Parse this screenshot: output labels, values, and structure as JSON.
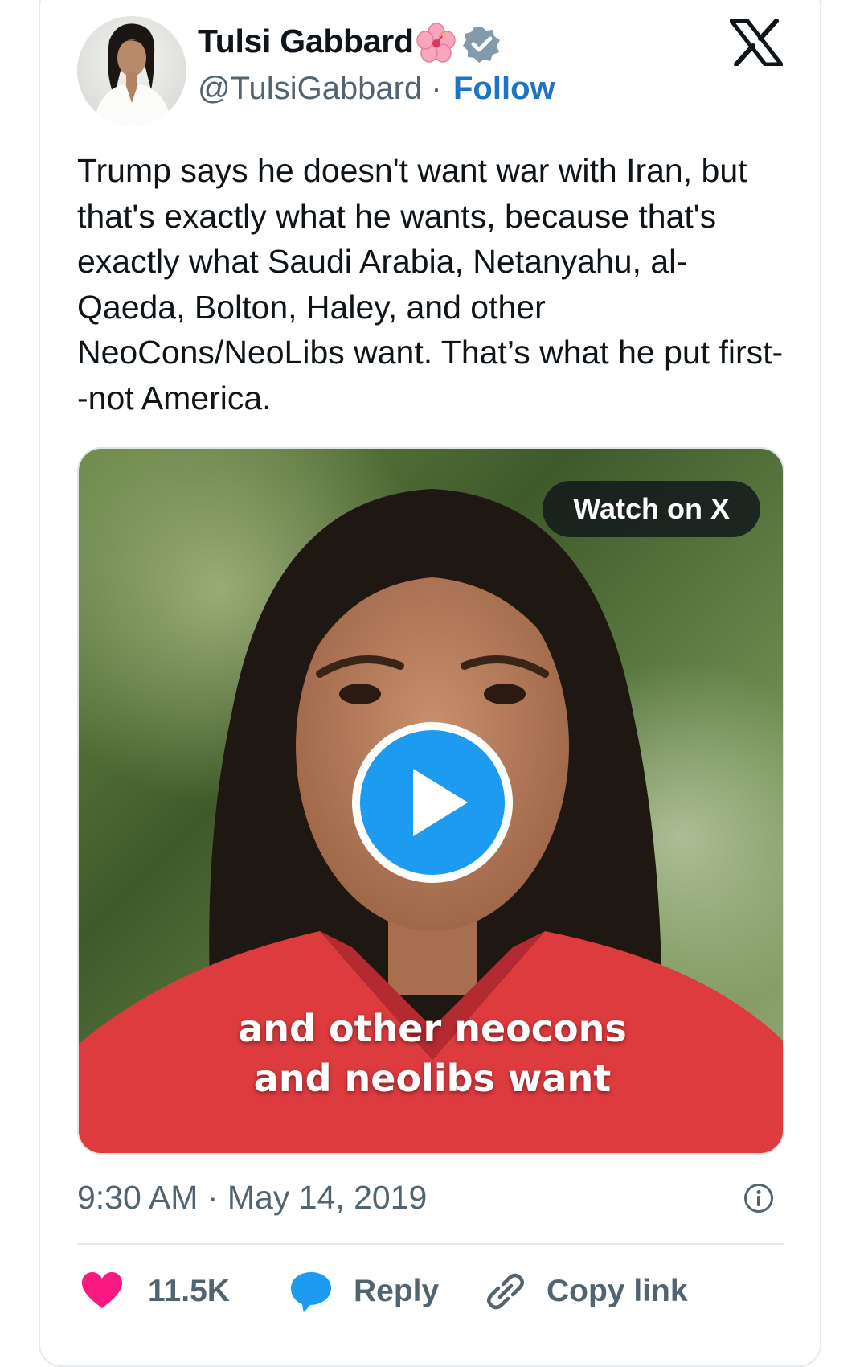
{
  "author": {
    "name": "Tulsi Gabbard",
    "handle": "@TulsiGabbard",
    "separator": "·",
    "follow_label": "Follow",
    "name_emoji_icon": "hibiscus-icon",
    "verified_icon": "verified-badge-icon"
  },
  "platform_icon": "x-logo-icon",
  "tweet": {
    "text": "Trump says he doesn't want war with Iran, but that's exactly what he wants, because that's exactly what Saudi Arabia, Netanyahu, al-Qaeda, Bolton, Haley, and other NeoCons/NeoLibs want. That’s what he put first--not America."
  },
  "media": {
    "watch_label": "Watch on X",
    "caption_line1": "and other neocons",
    "caption_line2": "and neolibs want",
    "play_icon": "play-icon"
  },
  "meta": {
    "timestamp": "9:30 AM · May 14, 2019",
    "info_icon": "info-icon"
  },
  "actions": {
    "like_count": "11.5K",
    "reply_label": "Reply",
    "copy_link_label": "Copy link"
  },
  "colors": {
    "follow": "#1d73c4",
    "like": "#f91880",
    "reply": "#1d9bf0",
    "secondary_text": "#536471",
    "verified": "#829aab"
  }
}
